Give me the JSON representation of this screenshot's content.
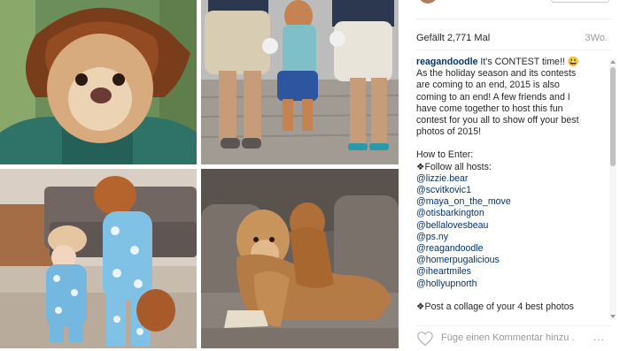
{
  "post": {
    "likes": "Gefällt 2,771 Mal",
    "time": "3Wo."
  },
  "caption": {
    "username": "reagandoodle",
    "lines": [
      "It's CONTEST time!! 😃",
      "As the holiday season and its contests",
      "are coming to an end, 2015 is also",
      "coming to an end! A few friends and I",
      "have come together to host this fun",
      "contest for you all to show off your best",
      "photos of 2015!"
    ],
    "how_to": "How to Enter:",
    "follow": "❖Follow all hosts:",
    "mentions": [
      "@lizzie.bear",
      "@scvitkovic1",
      "@maya_on_the_move",
      "@otisbarkington",
      "@bellalovesbeau",
      "@ps.ny",
      "@reagandoodle",
      "@homerpugalicious",
      "@iheartmiles",
      "@hollyupnorth"
    ],
    "post_line": "❖Post a collage of your 4 best photos"
  },
  "comment": {
    "placeholder": "Füge einen Kommentar hinzu ...",
    "more": "..."
  },
  "icons": {
    "like": "heart-icon",
    "more": "more-options-icon",
    "avatar": "profile-avatar"
  },
  "colors": {
    "username": "#003569",
    "text": "#262626",
    "muted": "#999999"
  }
}
